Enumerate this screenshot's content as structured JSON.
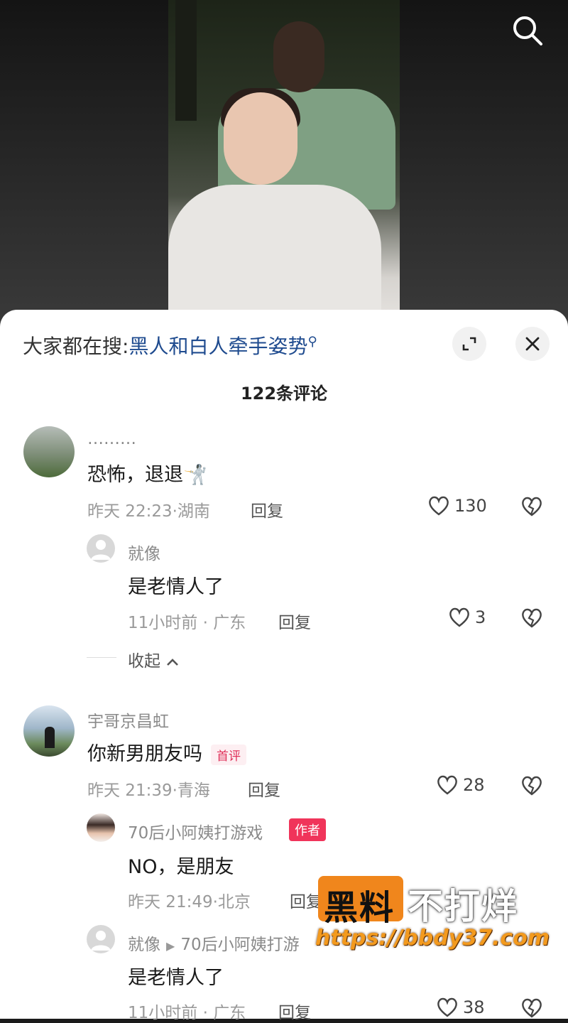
{
  "search": {
    "hint": "大家都在搜:",
    "query": "黑人和白人牵手姿势"
  },
  "comment_count": "122条评论",
  "reply_label": "回复",
  "collapse_label": "收起",
  "comments": [
    {
      "user": "………",
      "text": "恐怖，退退",
      "emoji": "🤺",
      "time": "昨天 22:23·湖南",
      "likes": "130"
    },
    {
      "user": "就像",
      "text": "是老情人了",
      "time": "11小时前 · 广东",
      "likes": "3"
    },
    {
      "user": "宇哥京昌虹",
      "text": "你新男朋友吗",
      "badge": "首评",
      "time": "昨天 21:39·青海",
      "likes": "28"
    },
    {
      "user": "70后小阿姨打游戏",
      "author_badge": "作者",
      "text": "NO，是朋友",
      "time": "昨天 21:49·北京"
    },
    {
      "user": "就像",
      "reply_to": "70后小阿姨打游",
      "text": "是老情人了",
      "time": "11小时前 · 广东",
      "likes": "38"
    }
  ],
  "watermark": {
    "part1": "黑料",
    "part2": "不打烊",
    "url": "https://bbdy37.com"
  }
}
